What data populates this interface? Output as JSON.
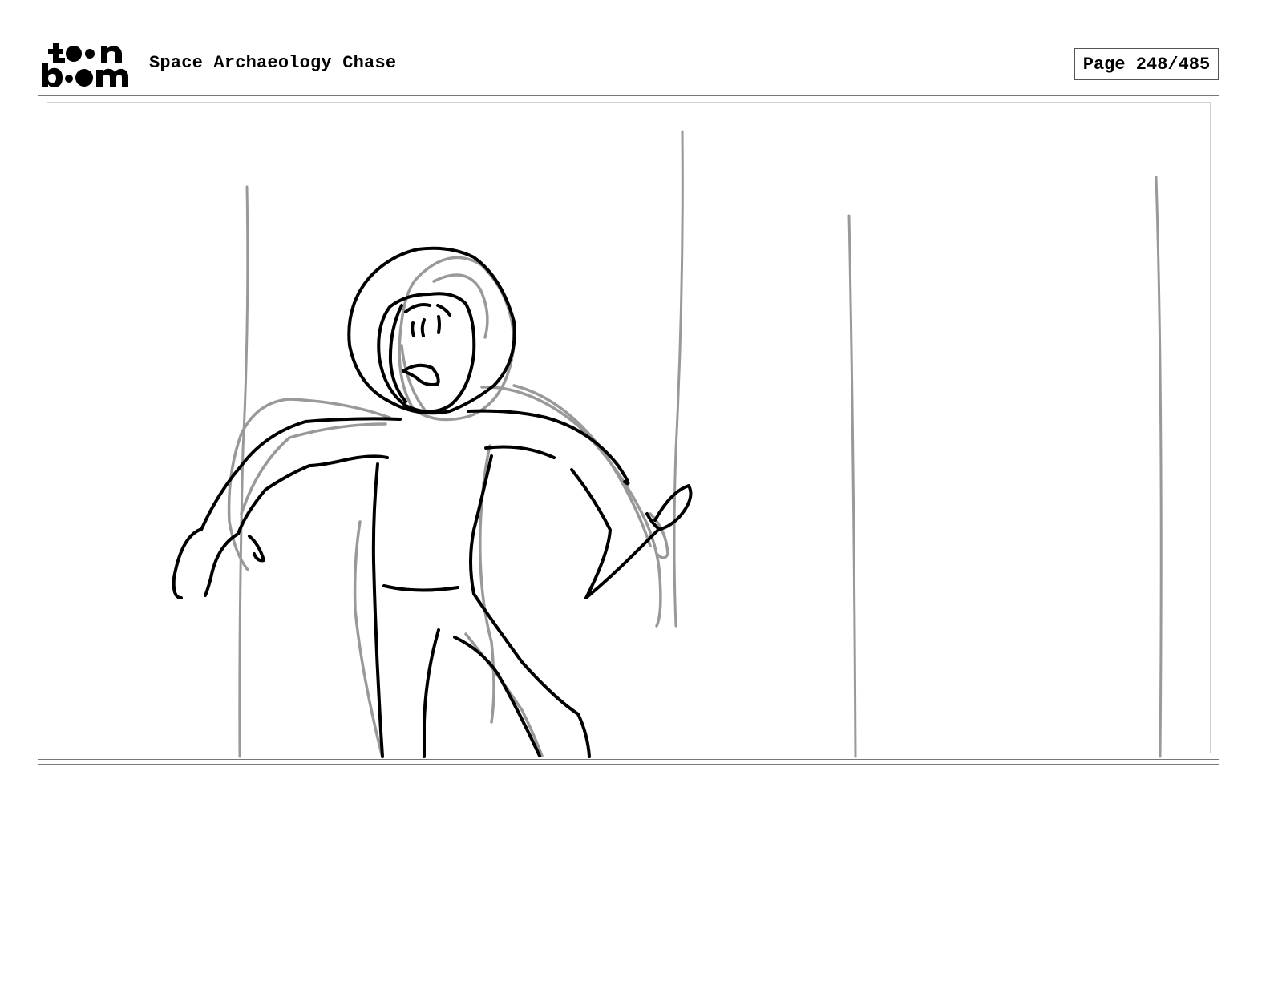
{
  "header": {
    "logo_text_top": "toon",
    "logo_text_bottom": "boom",
    "project_title": "Space Archaeology Chase",
    "page_label": "Page 248/485"
  },
  "panel": {
    "caption_text": ""
  },
  "colors": {
    "ink": "#000000",
    "rough": "#999999",
    "frame": "#777777"
  }
}
